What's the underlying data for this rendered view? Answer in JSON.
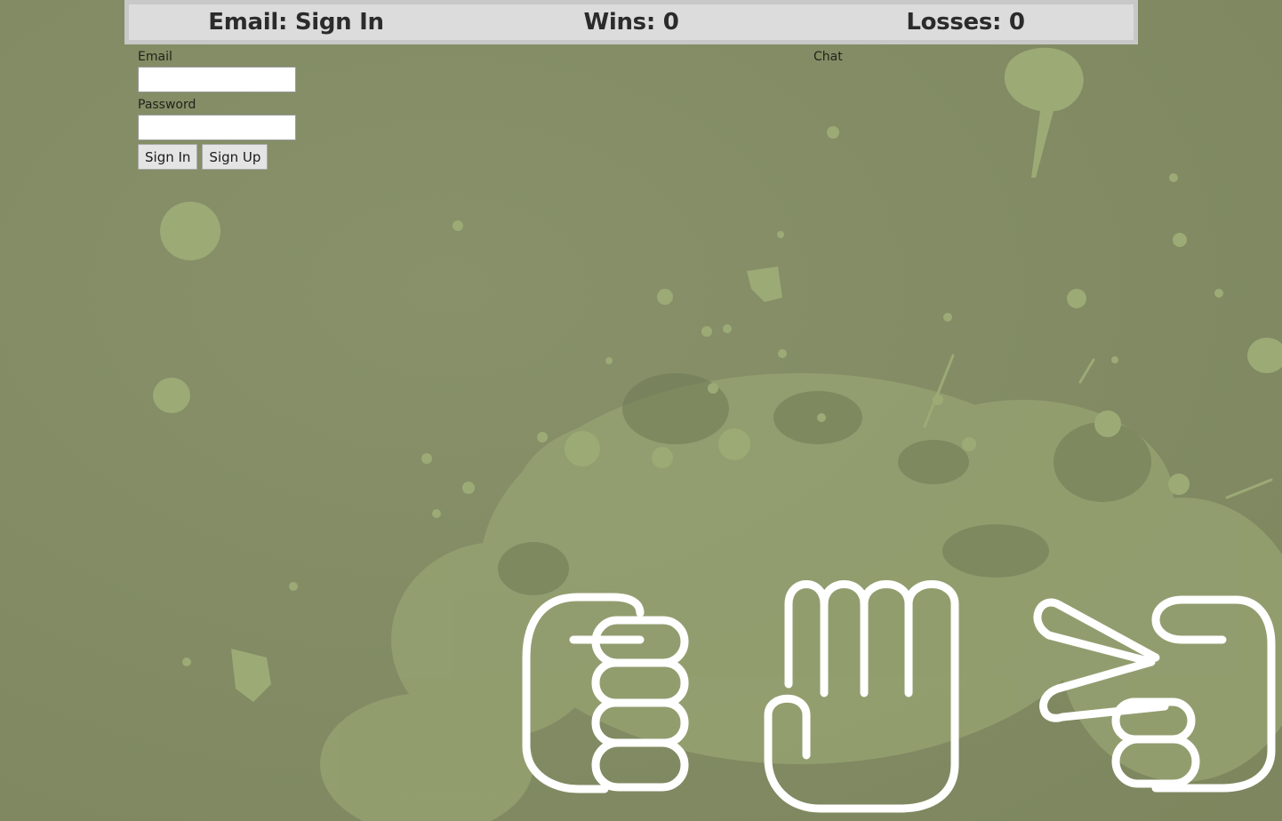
{
  "scoreboard": {
    "email_status": "Email: Sign In",
    "wins": "Wins: 0",
    "losses": "Losses: 0"
  },
  "login": {
    "email_label": "Email",
    "email_value": "",
    "password_label": "Password",
    "password_value": "",
    "sign_in_label": "Sign In",
    "sign_up_label": "Sign Up"
  },
  "chat": {
    "label": "Chat"
  },
  "hands": [
    "rock-icon",
    "paper-icon",
    "scissors-icon"
  ],
  "colors": {
    "background": "#838c63",
    "splatter": "#9aa874",
    "splatter_dark": "#6e7954",
    "scorebar": "#dcdcdc",
    "hand_stroke": "#ffffff"
  }
}
